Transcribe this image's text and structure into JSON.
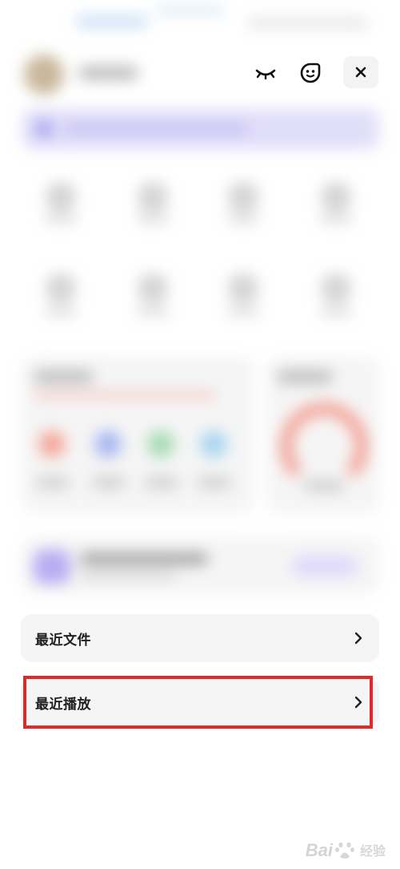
{
  "header": {
    "icons": {
      "hide": "eye-closed-icon",
      "assistant": "face-icon",
      "close": "close-icon"
    }
  },
  "list": {
    "items": [
      {
        "label": "最近文件"
      },
      {
        "label": "最近播放"
      }
    ]
  },
  "annotation": {
    "highlight_color": "#e02a2a"
  },
  "watermark": {
    "brand": "Bai",
    "suffix": "经验"
  },
  "colors": {
    "row_bg": "#f5f5f5",
    "close_bg": "#f3f3f3"
  }
}
